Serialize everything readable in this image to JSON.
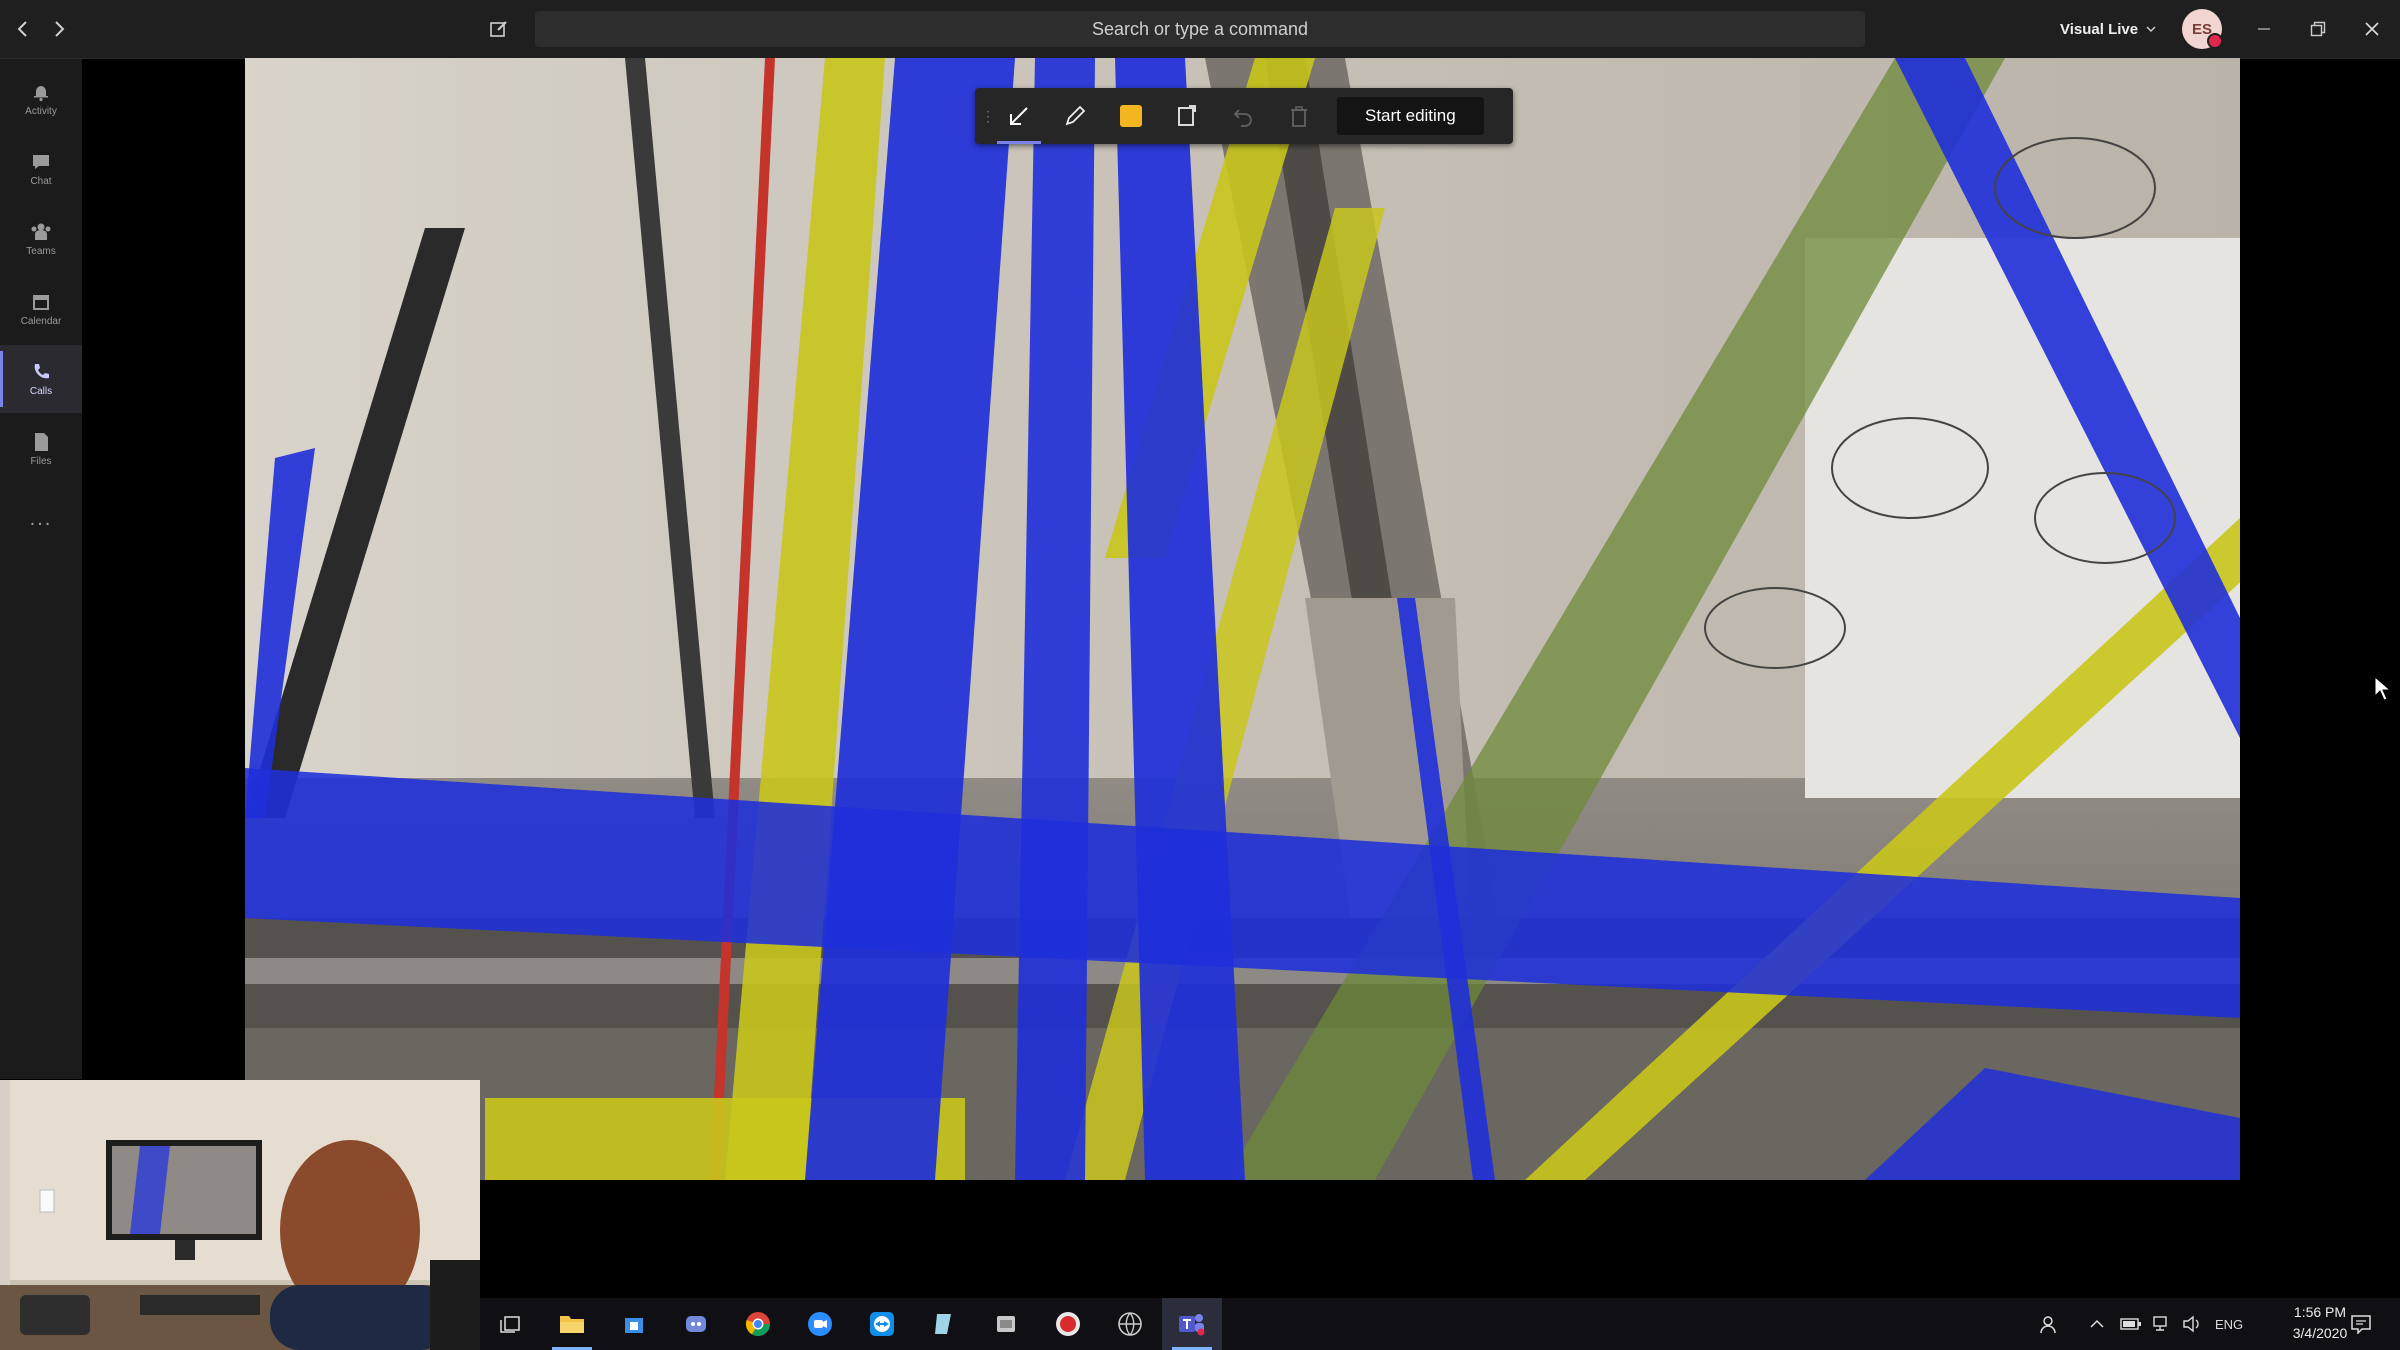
{
  "titlebar": {
    "search_placeholder": "Search or type a command",
    "org_name": "Visual Live",
    "avatar_initials": "ES"
  },
  "rail": {
    "items": [
      {
        "label": "Activity",
        "icon": "bell-icon"
      },
      {
        "label": "Chat",
        "icon": "chat-icon"
      },
      {
        "label": "Teams",
        "icon": "teams-icon"
      },
      {
        "label": "Calendar",
        "icon": "calendar-icon"
      },
      {
        "label": "Calls",
        "icon": "phone-icon",
        "active": true
      },
      {
        "label": "Files",
        "icon": "file-icon"
      },
      {
        "label": "...",
        "icon": "more-icon"
      }
    ]
  },
  "annotation_toolbar": {
    "tools": [
      "arrow-tool-icon",
      "pen-icon",
      "color-swatch-icon",
      "shape-icon",
      "undo-icon",
      "delete-icon"
    ],
    "selected_tool": "arrow-tool-icon",
    "swatch_color": "#f3b61f",
    "start_editing_label": "Start editing"
  },
  "taskbar": {
    "apps": [
      "task-view-icon",
      "file-explorer-icon",
      "store-icon",
      "discord-icon",
      "chrome-icon",
      "app-zoom-icon",
      "teamviewer-icon",
      "notes-icon",
      "app-icon",
      "app-red-icon",
      "app-globe-icon",
      "teams-icon"
    ],
    "language": "ENG",
    "time": "1:56 PM",
    "date": "3/4/2020"
  },
  "colors": {
    "accent": "#7b83eb",
    "overlay_blue": "#1f2fd9",
    "overlay_yellow": "#c9c51c",
    "overlay_green": "#6f8a3a"
  }
}
